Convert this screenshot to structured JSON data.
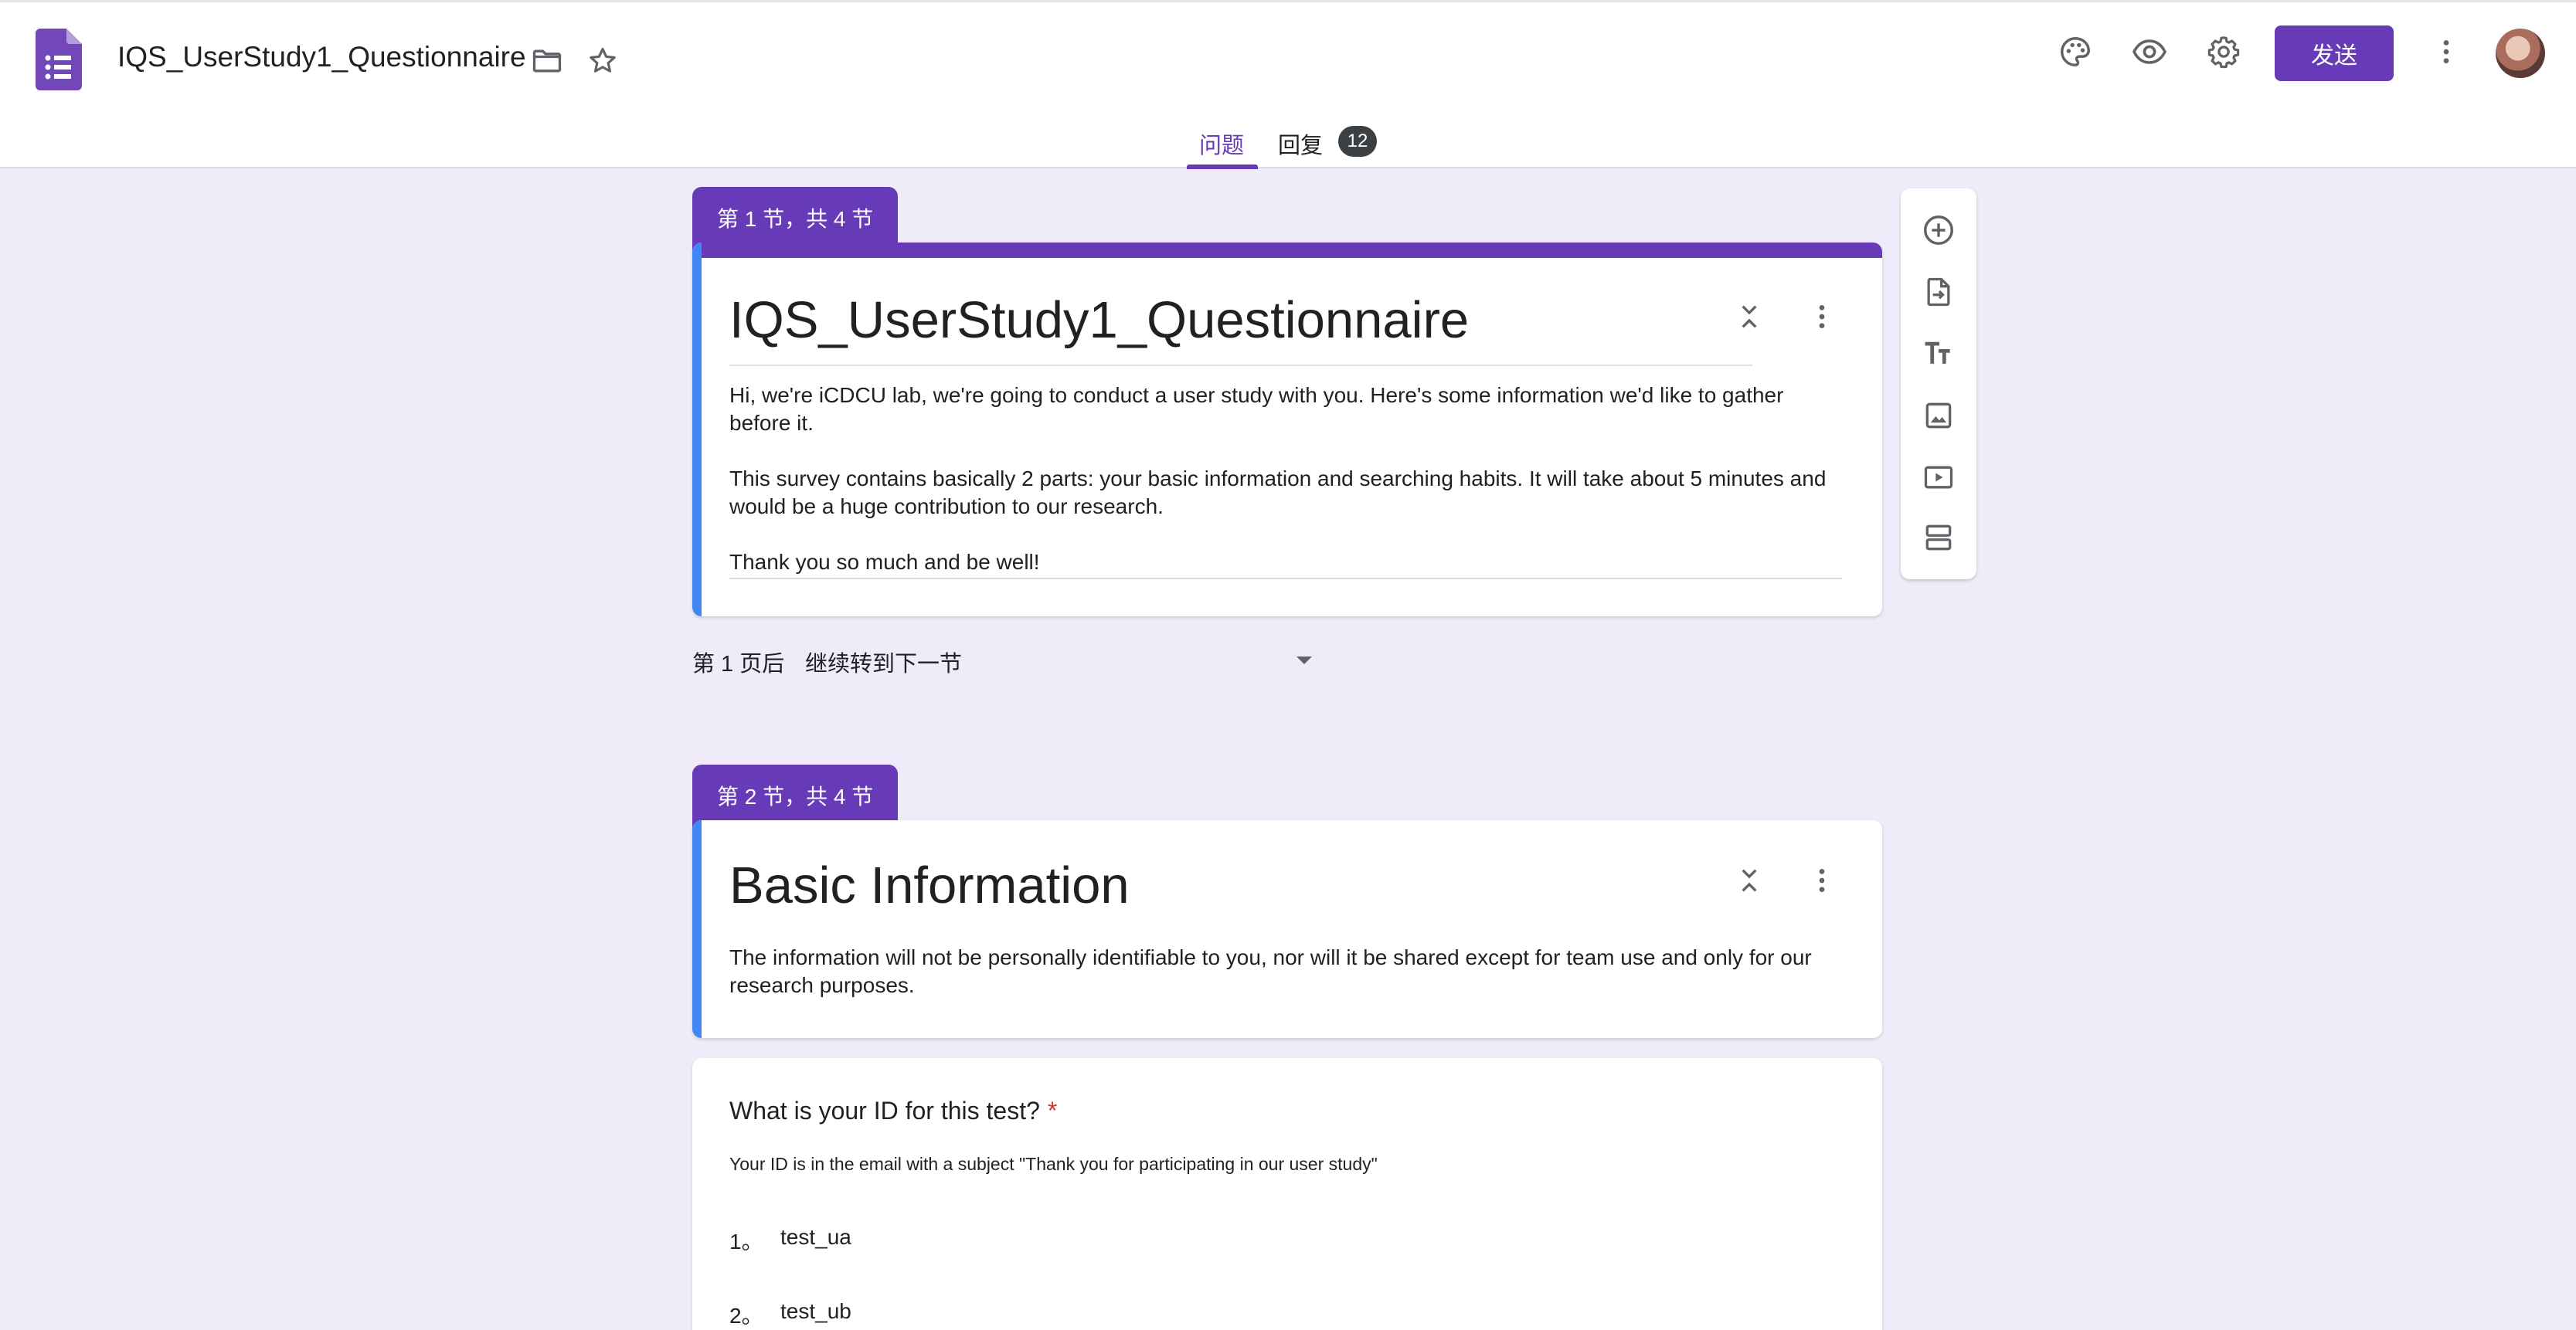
{
  "header": {
    "doc_title": "IQS_UserStudy1_Questionnaire",
    "send_label": "发送"
  },
  "tabs": {
    "questions": "问题",
    "responses": "回复",
    "responses_count": "12"
  },
  "sections": [
    {
      "tab_label": "第 1 节，共 4 节",
      "title": "IQS_UserStudy1_Questionnaire",
      "description": [
        "Hi, we're iCDCU lab, we're going to conduct a user study with you. Here's some information we'd like to gather before it.",
        "This survey contains basically 2 parts: your basic information and searching habits. It will take about 5 minutes and would be a huge contribution to our research.",
        "Thank you so much and be well!"
      ]
    },
    {
      "tab_label": "第 2 节，共 4 节",
      "title": "Basic Information",
      "description": [
        "The information will not be personally identifiable to you, nor will it be shared except for team use and only for our research purposes."
      ]
    }
  ],
  "after_section": {
    "label": "第 1 页后",
    "value": "继续转到下一节"
  },
  "question": {
    "title": "What is your ID for this test?",
    "required_mark": "*",
    "help_text": "Your ID is in the email with a subject \"Thank you for participating in our user study\"",
    "options": [
      {
        "num": "1。",
        "text": "test_ua"
      },
      {
        "num": "2。",
        "text": "test_ub"
      }
    ]
  },
  "colors": {
    "brand": "#673ab7",
    "accent_left": "#4285f4",
    "background": "#f0ebf8",
    "required": "#d93025"
  },
  "icons": [
    "forms-logo-icon",
    "folder-icon",
    "star-icon",
    "palette-icon",
    "eye-icon",
    "gear-icon",
    "more-vert-icon",
    "collapse-icon",
    "add-circle-icon",
    "import-icon",
    "title-icon",
    "image-icon",
    "video-icon",
    "section-icon"
  ]
}
